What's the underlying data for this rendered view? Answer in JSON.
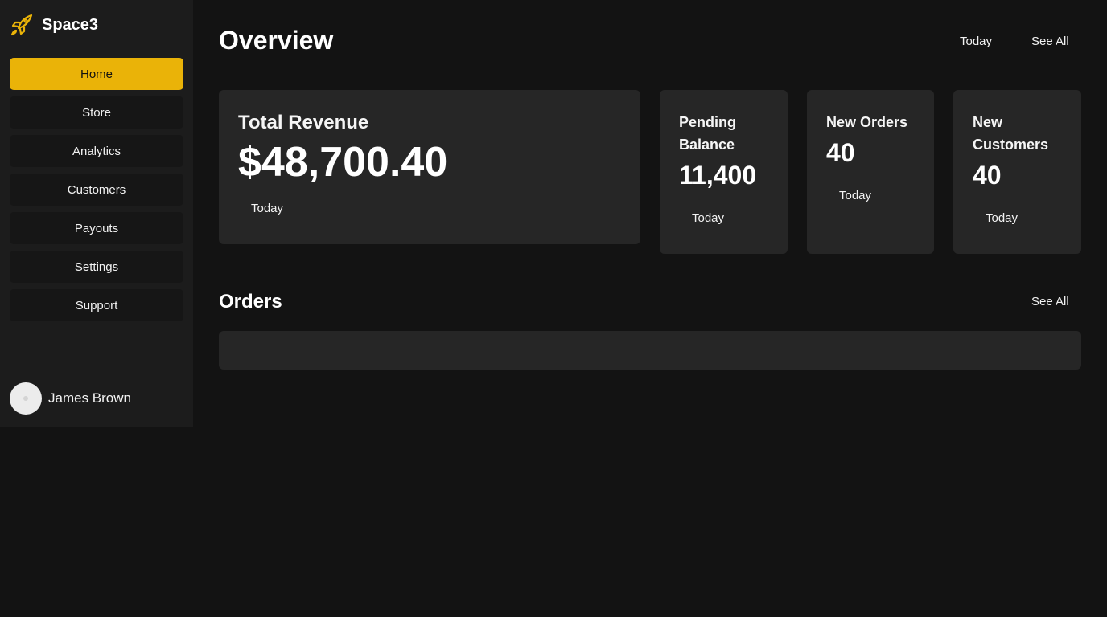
{
  "brand": {
    "name": "Space3",
    "icon": "rocket-icon",
    "accent": "#eab308"
  },
  "sidebar": {
    "items": [
      {
        "label": "Home",
        "active": true
      },
      {
        "label": "Store",
        "active": false
      },
      {
        "label": "Analytics",
        "active": false
      },
      {
        "label": "Customers",
        "active": false
      },
      {
        "label": "Payouts",
        "active": false
      },
      {
        "label": "Settings",
        "active": false
      },
      {
        "label": "Support",
        "active": false
      }
    ]
  },
  "user": {
    "name": "James Brown"
  },
  "overview": {
    "title": "Overview",
    "period_label": "Today",
    "see_all_label": "See All",
    "cards": [
      {
        "title": "Total Revenue",
        "value": "$48,700.40",
        "period": "Today"
      },
      {
        "title": "Pending Balance",
        "value": "11,400",
        "period": "Today"
      },
      {
        "title": "New Orders",
        "value": "40",
        "period": "Today"
      },
      {
        "title": "New Customers",
        "value": "40",
        "period": "Today"
      }
    ]
  },
  "orders": {
    "title": "Orders",
    "see_all_label": "See All"
  },
  "colors": {
    "background": "#131313",
    "sidebar": "#1c1c1c",
    "card": "#262626",
    "accent": "#eab308"
  }
}
